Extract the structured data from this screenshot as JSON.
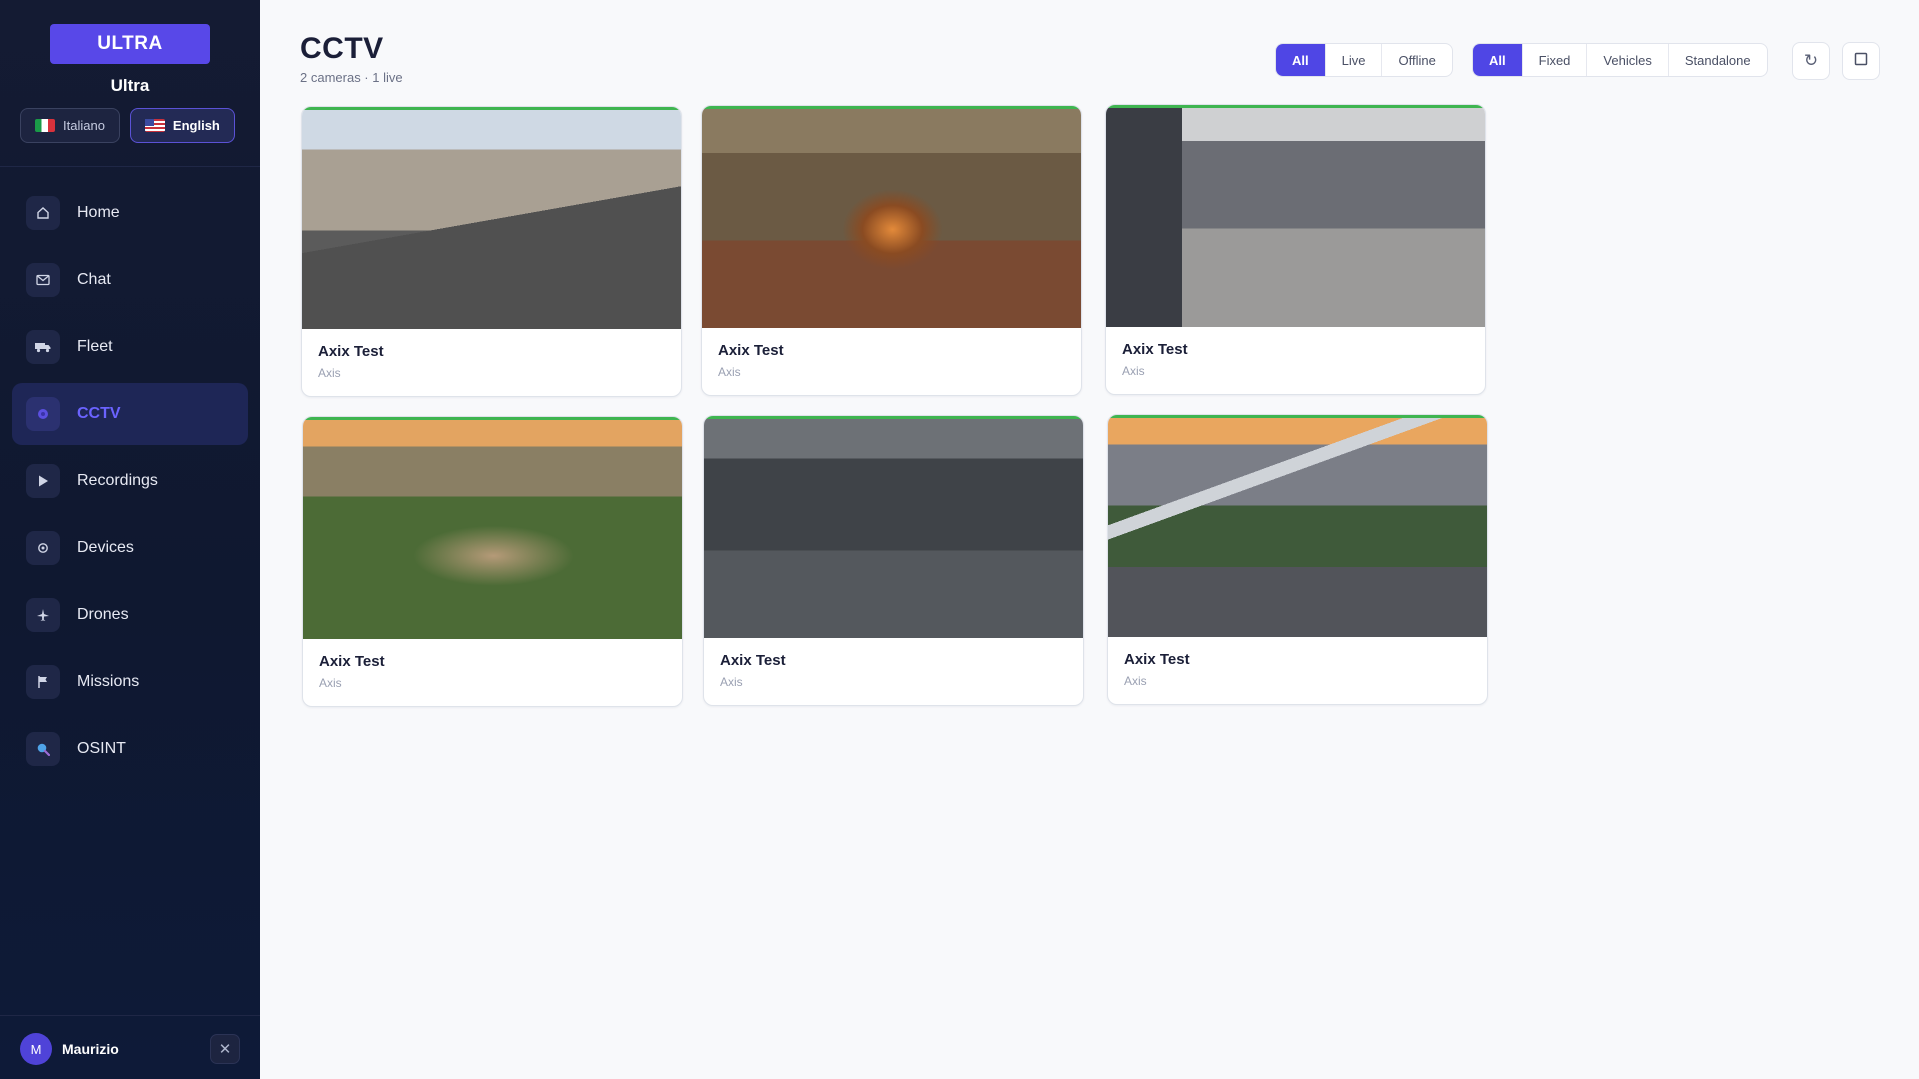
{
  "sidebar": {
    "brand_button": "ULTRA",
    "brand_name": "Ultra",
    "languages": [
      {
        "label": "Italiano",
        "active": false
      },
      {
        "label": "English",
        "active": true
      }
    ],
    "nav": [
      {
        "label": "Home",
        "icon": "home-icon"
      },
      {
        "label": "Chat",
        "icon": "mail-icon"
      },
      {
        "label": "Fleet",
        "icon": "truck-icon"
      },
      {
        "label": "CCTV",
        "icon": "camera-icon",
        "active": true
      },
      {
        "label": "Recordings",
        "icon": "play-icon"
      },
      {
        "label": "Devices",
        "icon": "gear-icon"
      },
      {
        "label": "Drones",
        "icon": "plane-icon"
      },
      {
        "label": "Missions",
        "icon": "flag-icon"
      },
      {
        "label": "OSINT",
        "icon": "magnifier-icon"
      }
    ],
    "user": {
      "initial": "M",
      "name": "Maurizio"
    }
  },
  "header": {
    "title": "CCTV",
    "subtitle": "2 cameras · 1 live"
  },
  "filters": {
    "status": [
      "All",
      "Live",
      "Offline"
    ],
    "type": [
      "All",
      "Fixed",
      "Vehicles",
      "Standalone"
    ]
  },
  "accent_color": "#4f46e5",
  "live_color": "#3fb550",
  "cameras": [
    {
      "title": "Axix Test",
      "brand": "Axis"
    },
    {
      "title": "Axix Test",
      "brand": "Axis"
    },
    {
      "title": "Axix Test",
      "brand": "Axis"
    },
    {
      "title": "Axix Test",
      "brand": "Axis"
    },
    {
      "title": "Axix Test",
      "brand": "Axis"
    },
    {
      "title": "Axix Test",
      "brand": "Axis"
    }
  ]
}
